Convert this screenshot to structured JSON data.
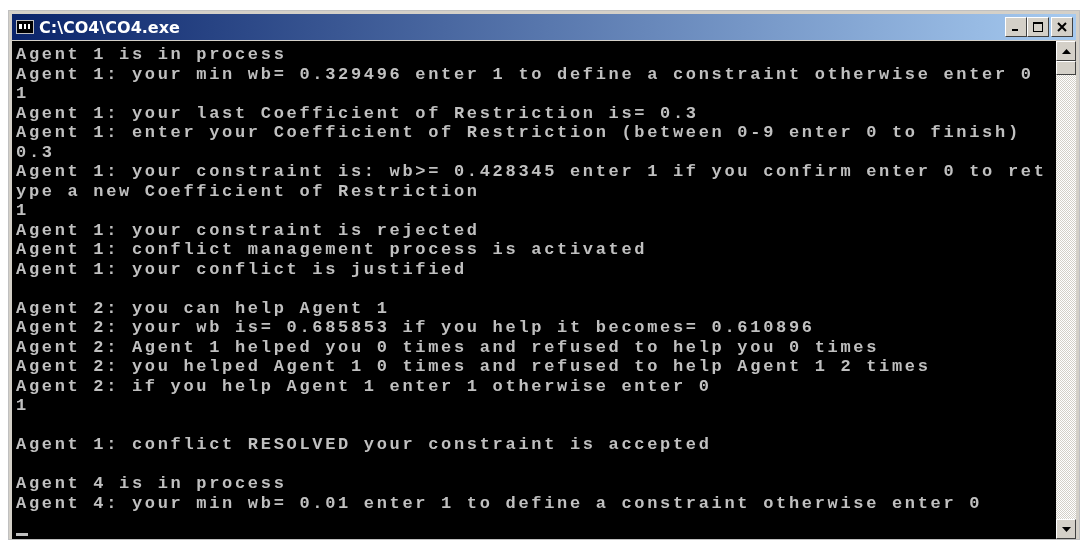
{
  "window": {
    "title": "C:\\CO4\\CO4.exe"
  },
  "console": {
    "blocks": [
      [
        "Agent 1 is in process",
        "Agent 1: your min wb= 0.329496 enter 1 to define a constraint otherwise enter 0",
        "1",
        "Agent 1: your last Coefficient of Restriction is= 0.3",
        "Agent 1: enter your Coefficient of Restriction (between 0-9 enter 0 to finish)",
        "0.3",
        "Agent 1: your constraint is: wb>= 0.428345 enter 1 if you confirm enter 0 to ret",
        "ype a new Coefficient of Restriction",
        "1",
        "Agent 1: your constraint is rejected",
        "Agent 1: conflict management process is activated",
        "Agent 1: your conflict is justified"
      ],
      [
        "Agent 2: you can help Agent 1",
        "Agent 2: your wb is= 0.685853 if you help it becomes= 0.610896",
        "Agent 2: Agent 1 helped you 0 times and refused to help you 0 times",
        "Agent 2: you helped Agent 1 0 times and refused to help Agent 1 2 times",
        "Agent 2: if you help Agent 1 enter 1 otherwise enter 0",
        "1"
      ],
      [
        "Agent 1: conflict RESOLVED your constraint is accepted"
      ],
      [
        "Agent 4 is in process",
        "Agent 4: your min wb= 0.01 enter 1 to define a constraint otherwise enter 0"
      ]
    ]
  }
}
